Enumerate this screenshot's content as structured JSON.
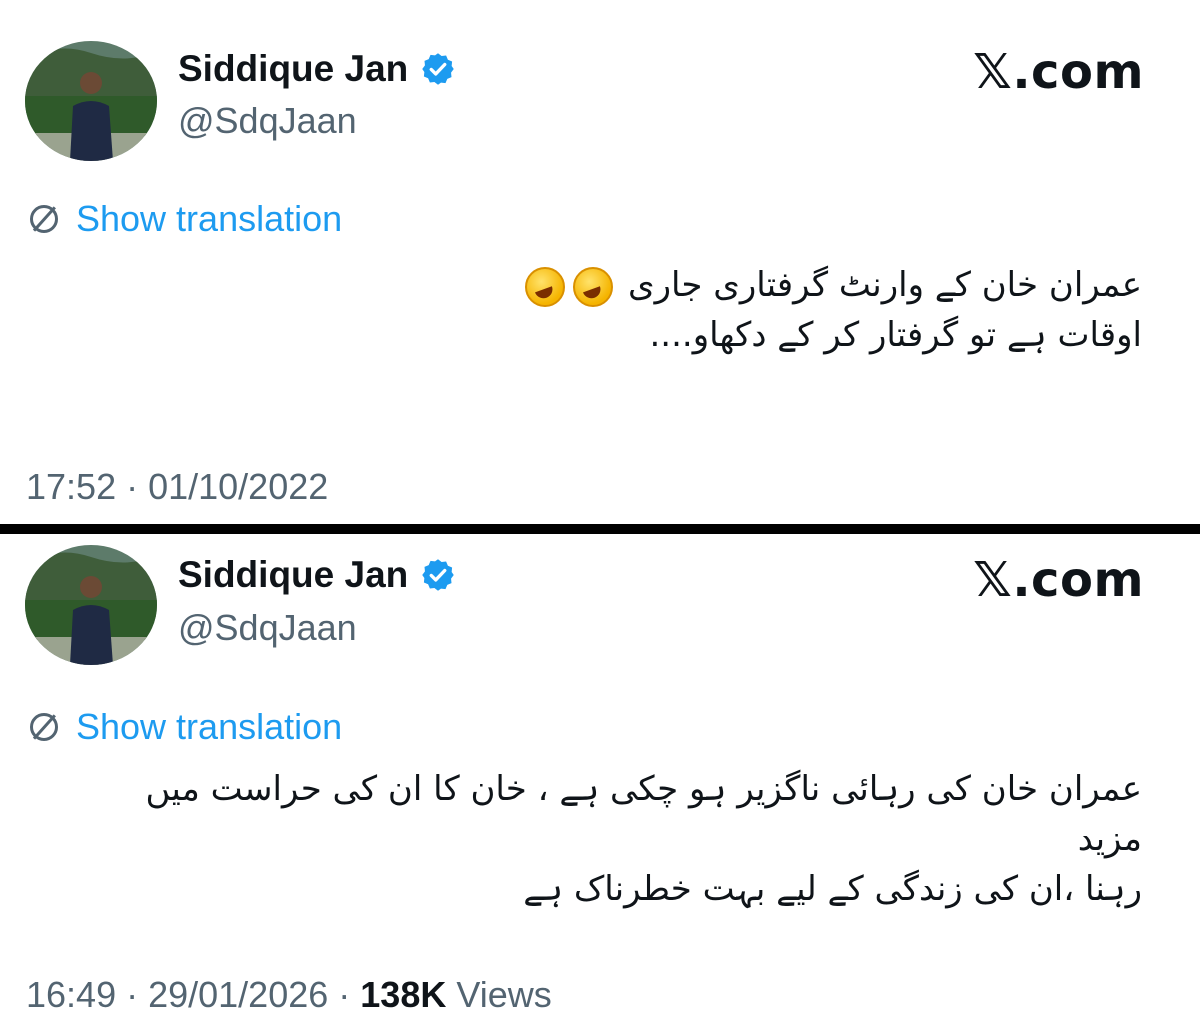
{
  "tweets": [
    {
      "author": {
        "name": "Siddique Jan",
        "handle": "@SdqJaan"
      },
      "brand": "𝕏.com",
      "translate_label": "Show translation",
      "text_lines": [
        "عمران خان کے وارنٹ گرفتاری جاری",
        "اوقات ہے تو گرفتار کر کے دکھاو...."
      ],
      "emojis": [
        "rofl-emoji",
        "rofl-emoji"
      ],
      "time": "17:52",
      "date": "01/10/2022",
      "separator": " · "
    },
    {
      "author": {
        "name": "Siddique Jan",
        "handle": "@SdqJaan"
      },
      "brand": "𝕏.com",
      "translate_label": "Show translation",
      "text_lines": [
        "عمران خان کی رہائی ناگزیر ہو چکی ہے ، خان کا ان کی حراست میں مزید",
        "رہنا ،ان کی زندگی کے لیے بہت خطرناک ہے"
      ],
      "time": "16:49",
      "date": "29/01/2026",
      "separator": " · ",
      "views_count": "138K",
      "views_label": "Views"
    }
  ],
  "colors": {
    "link": "#1d9bf0",
    "secondary_text": "#536471",
    "verified": "#1d9bf0",
    "divider": "#000000"
  },
  "icons": {
    "verified": "verified-badge-icon",
    "translate": "globe-icon"
  }
}
